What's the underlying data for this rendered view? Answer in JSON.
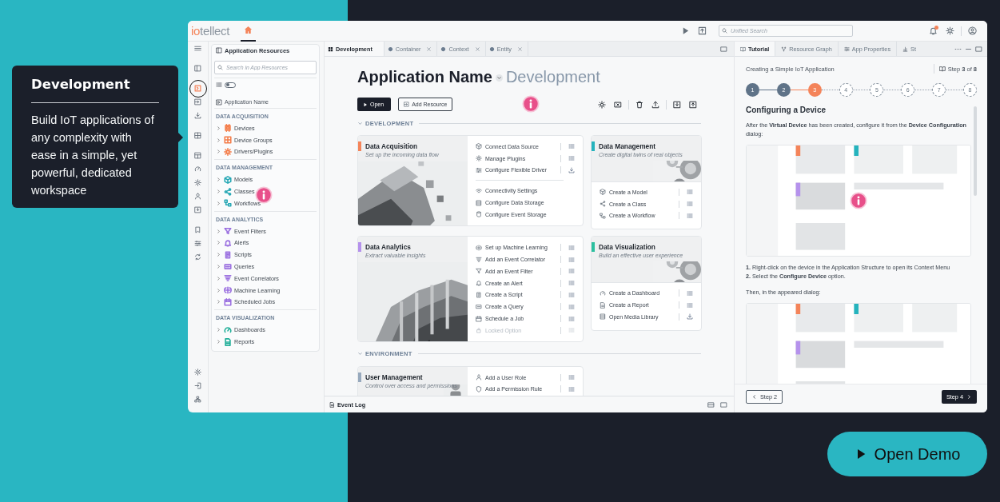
{
  "callout": {
    "title": "Development",
    "text": "Build IoT applications of any complexity with ease in a simple, yet powerful, dedicated workspace"
  },
  "topbar": {
    "logo": [
      "io",
      "tellect"
    ],
    "search_placeholder": "Unified Search",
    "has_notifications": true
  },
  "rail": {
    "groups": [
      [
        {
          "selected": false
        }
      ],
      [
        {
          "selected": false
        }
      ],
      [
        {
          "selected": true
        },
        {
          "selected": false
        },
        {
          "selected": false
        }
      ],
      [
        {
          "selected": false
        }
      ],
      [
        {
          "selected": false
        },
        {
          "selected": false
        },
        {
          "selected": false
        },
        {
          "selected": false
        },
        {
          "selected": false
        }
      ],
      [
        {
          "selected": false
        },
        {
          "selected": false
        },
        {
          "selected": false
        }
      ]
    ],
    "bottom": [
      {
        "selected": false
      },
      {
        "selected": false
      },
      {
        "selected": false
      }
    ]
  },
  "resources": {
    "title": "Application Resources",
    "search_placeholder": "Search in App Resources",
    "toggle_on": false,
    "root": "Application Name",
    "groups": [
      {
        "title": "DATA ACQUISITION",
        "color": "#f47c48",
        "items": [
          {
            "label": "Devices",
            "expanded": false
          },
          {
            "label": "Device Groups",
            "expanded": false
          },
          {
            "label": "Drivers/Plugins",
            "expanded": false
          }
        ]
      },
      {
        "title": "DATA MANAGEMENT",
        "color": "#25a7b4",
        "items": [
          {
            "label": "Models",
            "expanded": false
          },
          {
            "label": "Classes",
            "expanded": false
          },
          {
            "label": "Workflows",
            "expanded": false
          }
        ]
      },
      {
        "title": "DATA ANALYTICS",
        "color": "#9a6fe0",
        "items": [
          {
            "label": "Event Filters",
            "expanded": false
          },
          {
            "label": "Alerts",
            "expanded": false
          },
          {
            "label": "Scripts",
            "expanded": false
          },
          {
            "label": "Queries",
            "expanded": false
          },
          {
            "label": "Event Correlators",
            "expanded": false
          },
          {
            "label": "Machine Learning",
            "expanded": false
          },
          {
            "label": "Scheduled Jobs",
            "expanded": false
          }
        ]
      },
      {
        "title": "DATA VISUALIZATION",
        "color": "#1fae98",
        "items": [
          {
            "label": "Dashboards",
            "expanded": false
          },
          {
            "label": "Reports",
            "expanded": false
          }
        ]
      }
    ]
  },
  "tabs": [
    {
      "label": "Development",
      "selected": true
    },
    {
      "label": "Container",
      "selected": false
    },
    {
      "label": "Context",
      "selected": false
    },
    {
      "label": "Entity",
      "selected": false
    }
  ],
  "workspace": {
    "title": "Application Name",
    "subtitle": "Development",
    "open_button": "Open",
    "add_button": "Add Resource",
    "sections": [
      {
        "title": "DEVELOPMENT",
        "expanded": true,
        "cards": [
          {
            "title": "Data Acquisition",
            "subtitle": "Set up the incoming data flow",
            "color": "#f4845a",
            "kind": "side",
            "action_groups": [
              [
                {
                  "label": "Connect Data Source",
                  "disabled": false
                },
                {
                  "label": "Manage Plugins",
                  "disabled": false
                },
                {
                  "label": "Configure Flexible Driver",
                  "disabled": false
                }
              ],
              [
                {
                  "label": "Connectivity Settings",
                  "disabled": false
                },
                {
                  "label": "Configure Data Storage",
                  "disabled": false
                },
                {
                  "label": "Configure Event Storage",
                  "disabled": false
                }
              ]
            ]
          },
          {
            "title": "Data Management",
            "subtitle": "Create digital twins of real objects",
            "color": "#25b3bd",
            "kind": "top",
            "action_groups": [
              [
                {
                  "label": "Create a Model",
                  "disabled": false
                },
                {
                  "label": "Create a Class",
                  "disabled": false
                },
                {
                  "label": "Create a Workflow",
                  "disabled": false
                }
              ]
            ]
          },
          {
            "title": "Data Analytics",
            "subtitle": "Extract valuable insights",
            "color": "#b592ec",
            "kind": "side",
            "action_groups": [
              [
                {
                  "label": "Set up Machine Learning",
                  "disabled": false
                },
                {
                  "label": "Add an Event Correlator",
                  "disabled": false
                },
                {
                  "label": "Add an Event Filter",
                  "disabled": false
                },
                {
                  "label": "Create an Alert",
                  "disabled": false
                },
                {
                  "label": "Create a Script",
                  "disabled": false
                },
                {
                  "label": "Create a Query",
                  "disabled": false
                },
                {
                  "label": "Schedule a Job",
                  "disabled": false
                },
                {
                  "label": "Locked Option",
                  "disabled": true
                }
              ]
            ]
          },
          {
            "title": "Data Visualization",
            "subtitle": "Build an effective user experience",
            "color": "#2bbf9f",
            "kind": "top",
            "action_groups": [
              [
                {
                  "label": "Create a Dashboard",
                  "disabled": false
                },
                {
                  "label": "Create a Report",
                  "disabled": false
                },
                {
                  "label": "Open Media Library",
                  "disabled": false
                }
              ]
            ]
          }
        ]
      },
      {
        "title": "ENVIRONMENT",
        "expanded": true,
        "cards": [
          {
            "title": "User Management",
            "subtitle": "Control over access and permissions",
            "color": "#97a9bd",
            "kind": "side",
            "action_groups": [
              [
                {
                  "label": "Add a User Role",
                  "disabled": false
                },
                {
                  "label": "Add a Permission Rule",
                  "disabled": false
                }
              ]
            ]
          }
        ]
      }
    ]
  },
  "event_log": "Event Log",
  "tutorial": {
    "tabs": [
      {
        "label": "Tutorial",
        "selected": true
      },
      {
        "label": "Resource Graph",
        "selected": false
      },
      {
        "label": "App Properties",
        "selected": false
      },
      {
        "label": "St",
        "selected": false
      }
    ],
    "title": "Creating a Simple IoT Application",
    "step_counter": "Step **3** of **8**",
    "steps": [
      {
        "label": "1",
        "done": true,
        "selected": false
      },
      {
        "label": "2",
        "done": true,
        "selected": false
      },
      {
        "label": "3",
        "done": false,
        "selected": true
      },
      {
        "label": "4",
        "done": false,
        "selected": false
      },
      {
        "label": "5",
        "done": false,
        "selected": false
      },
      {
        "label": "6",
        "done": false,
        "selected": false
      },
      {
        "label": "7",
        "done": false,
        "selected": false
      },
      {
        "label": "8",
        "done": false,
        "selected": false
      }
    ],
    "heading": "Configuring a Device",
    "intro": "After the **Virtual Device** has been created, configure it from the **Device Configuration** dialog:",
    "instructions": [
      "**1.** Right-click on the device in the Application Structure to open its Context Menu",
      "**2.** Select the **Configure Device** option."
    ],
    "followup": "Then, in the appeared dialog:",
    "prev": "Step 2",
    "next": "Step 4"
  },
  "cta": "Open Demo"
}
